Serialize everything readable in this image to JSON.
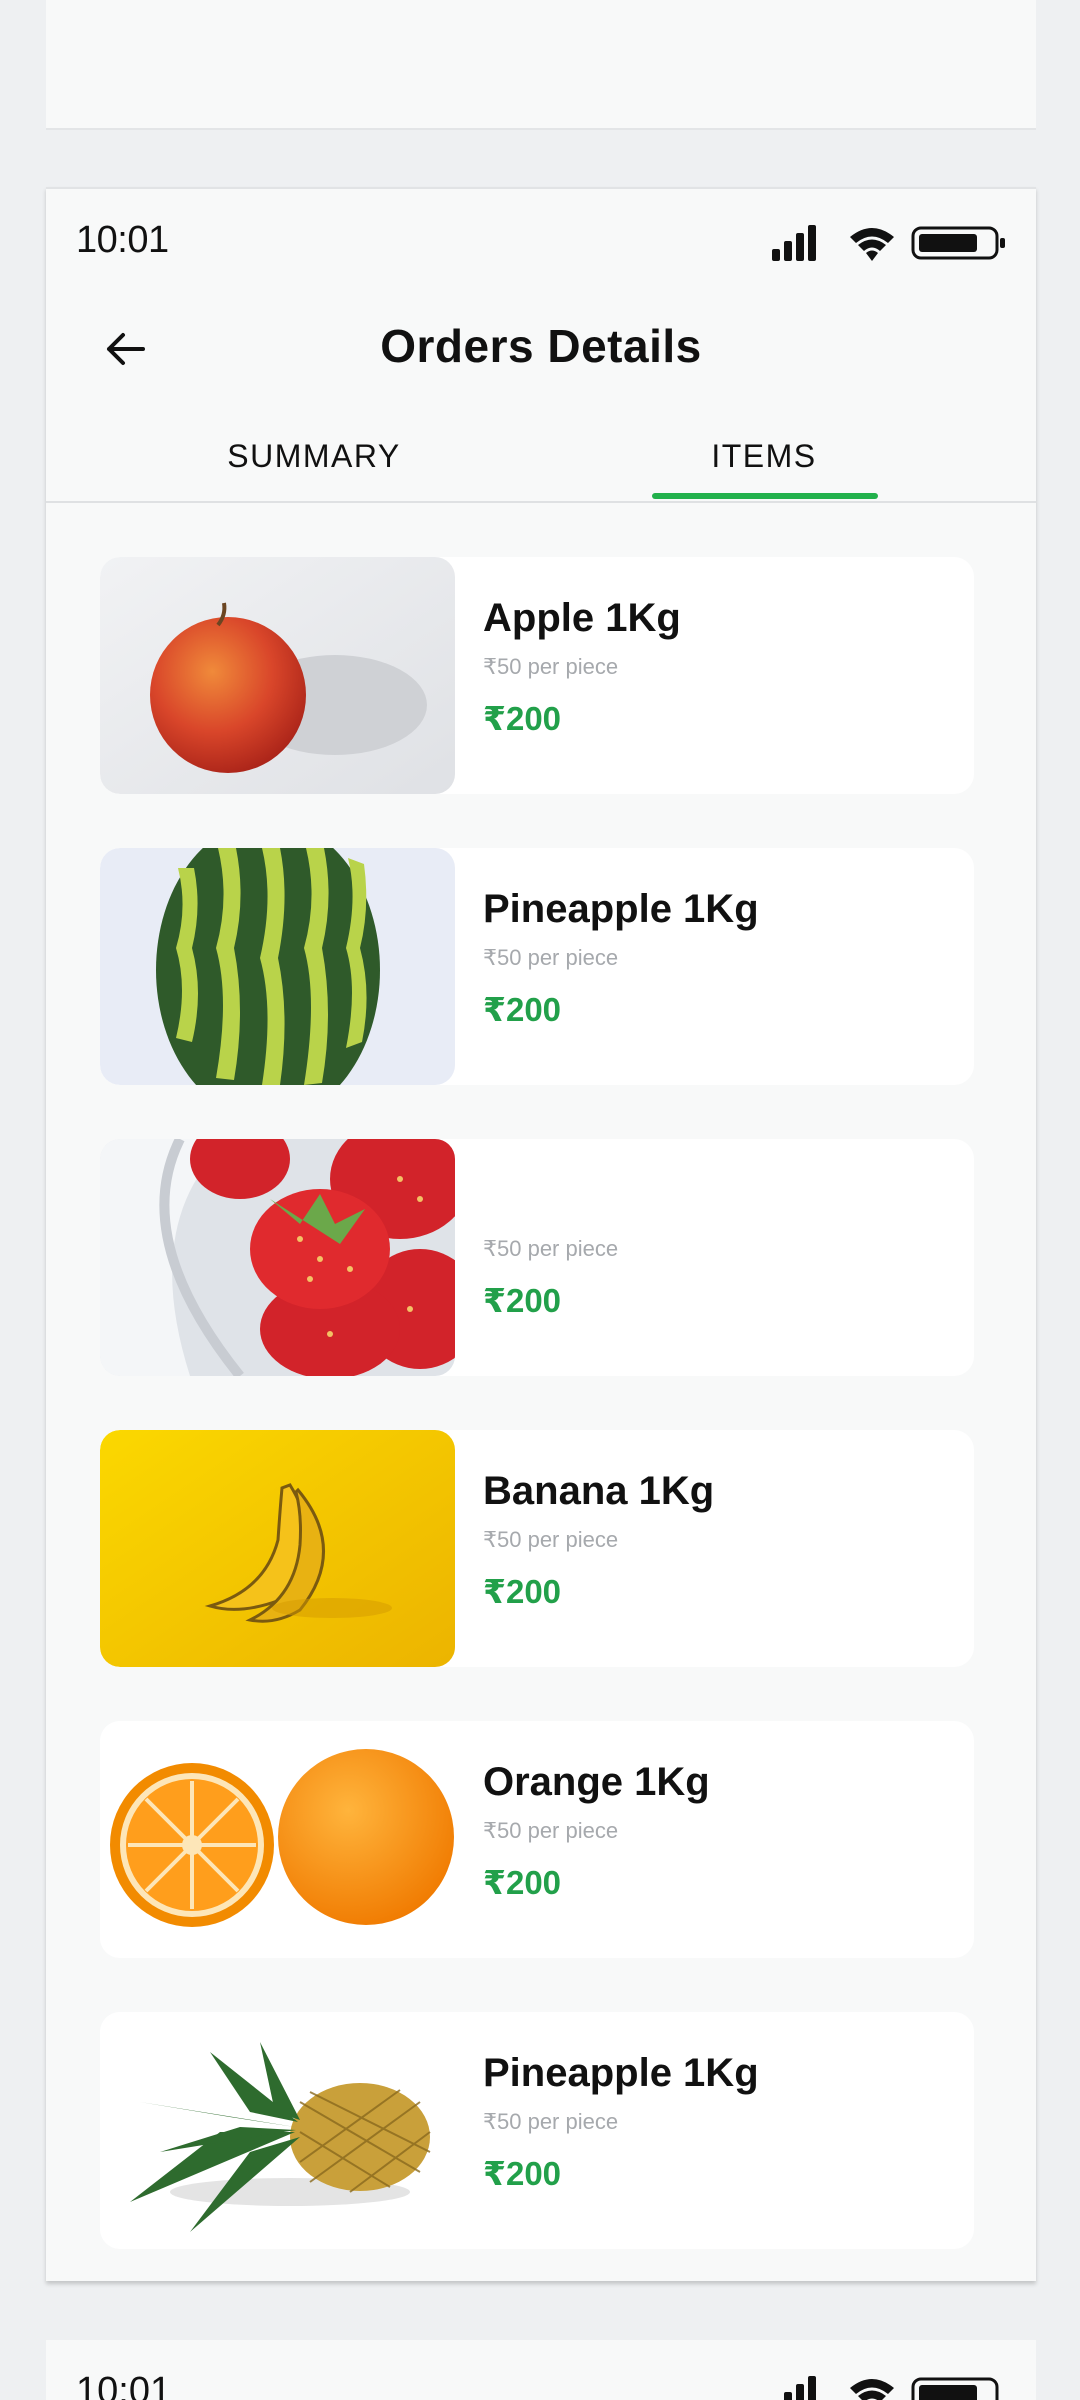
{
  "status": {
    "time": "10:01"
  },
  "header": {
    "title": "Orders Details"
  },
  "tabs": [
    {
      "label": "SUMMARY",
      "active": false
    },
    {
      "label": "ITEMS",
      "active": true
    }
  ],
  "items": [
    {
      "name": "Apple 1Kg",
      "unit": "₹50 per piece",
      "price": "₹200",
      "image": "apple"
    },
    {
      "name": "Pineapple 1Kg",
      "unit": "₹50 per piece",
      "price": "₹200",
      "image": "watermelon"
    },
    {
      "name": "",
      "unit": "₹50 per piece",
      "price": "₹200",
      "image": "strawberry"
    },
    {
      "name": "Banana 1Kg",
      "unit": "₹50 per piece",
      "price": "₹200",
      "image": "banana"
    },
    {
      "name": "Orange 1Kg",
      "unit": "₹50 per piece",
      "price": "₹200",
      "image": "orange"
    },
    {
      "name": "Pineapple 1Kg",
      "unit": "₹50 per piece",
      "price": "₹200",
      "image": "pineapple"
    }
  ],
  "colors": {
    "accent": "#22b14c",
    "price": "#22a04a",
    "background": "#f8f9f9"
  }
}
